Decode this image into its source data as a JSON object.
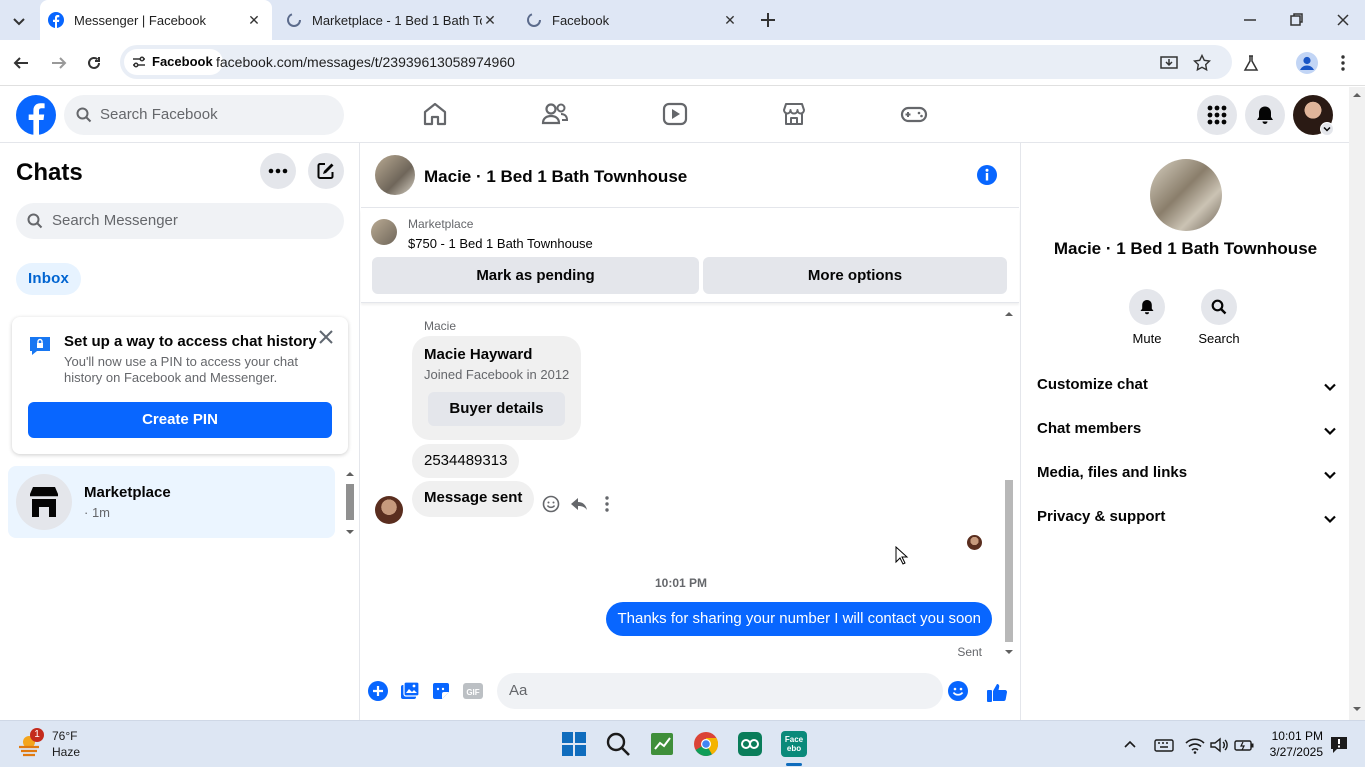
{
  "browser": {
    "tabs": [
      {
        "label": "Messenger | Facebook"
      },
      {
        "label": "Marketplace - 1 Bed 1 Bath Tow"
      },
      {
        "label": "Facebook"
      }
    ],
    "site_chip": "Facebook",
    "url": "facebook.com/messages/t/23939613058974960"
  },
  "fb_header": {
    "search_placeholder": "Search Facebook"
  },
  "chats": {
    "title": "Chats",
    "search_placeholder": "Search Messenger",
    "filter_label": "Inbox",
    "pin_card": {
      "title": "Set up a way to access chat history",
      "body": "You'll now use a PIN to access your chat history on Facebook and Messenger.",
      "button": "Create PIN"
    },
    "items": [
      {
        "name": "Marketplace",
        "time": "· 1m"
      }
    ]
  },
  "conversation": {
    "title": "Macie · 1 Bed 1 Bath Townhouse",
    "marketplace": {
      "label": "Marketplace",
      "listing": "$750 - 1 Bed 1 Bath Townhouse",
      "btn_pending": "Mark as pending",
      "btn_more": "More options"
    },
    "sender_name": "Macie",
    "card": {
      "name": "Macie Hayward",
      "sub": "Joined Facebook in 2012",
      "button": "Buyer details"
    },
    "msg_number": "2534489313",
    "msg_sent": "Message sent",
    "time_separator": "10:01 PM",
    "my_message": "Thanks for sharing your number I will contact you soon",
    "status": "Sent",
    "composer_placeholder": "Aa"
  },
  "details": {
    "title": "Macie · 1 Bed 1 Bath Townhouse",
    "actions": [
      {
        "label": "Mute"
      },
      {
        "label": "Search"
      }
    ],
    "sections": [
      {
        "label": "Customize chat"
      },
      {
        "label": "Chat members"
      },
      {
        "label": "Media, files and links"
      },
      {
        "label": "Privacy & support"
      }
    ]
  },
  "taskbar": {
    "weather_temp": "76°F",
    "weather_cond": "Haze",
    "weather_badge": "1",
    "time": "10:01 PM",
    "date": "3/27/2025"
  },
  "colors": {
    "brand_blue": "#0866ff",
    "bubble_gray": "#f0f0f0",
    "inbox_bg": "#e7f3ff"
  }
}
